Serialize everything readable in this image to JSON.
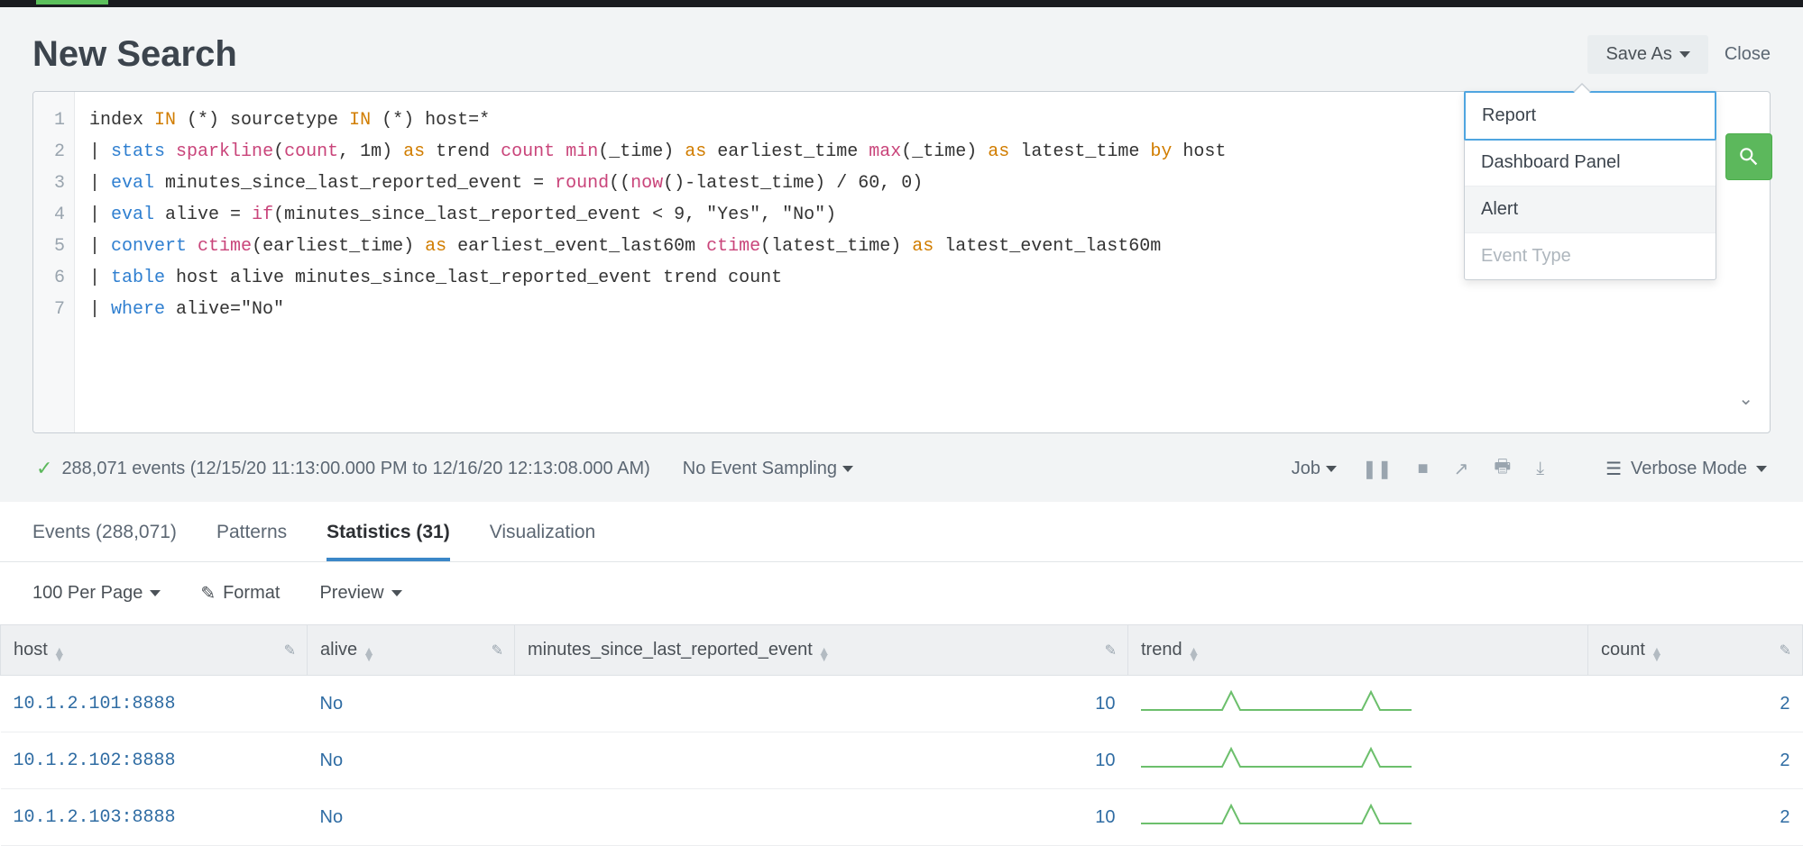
{
  "header": {
    "title": "New Search",
    "save_as": "Save As",
    "close": "Close",
    "dropdown": {
      "report": "Report",
      "dashboard": "Dashboard Panel",
      "alert": "Alert",
      "event_type": "Event Type"
    }
  },
  "query": {
    "lines": [
      "1",
      "2",
      "3",
      "4",
      "5",
      "6",
      "7"
    ],
    "l1": {
      "a": "index ",
      "op1": "IN",
      "b": " (*) sourcetype ",
      "op2": "IN",
      "c": " (*) host=*"
    },
    "l2": {
      "a": "| ",
      "cmd": "stats",
      "sp": " ",
      "fn": "sparkline",
      "b": "(",
      "cnt": "count",
      "c": ", 1m) ",
      "as1": "as",
      "d": " trend ",
      "cnt2": "count",
      "sp2": " ",
      "min": "min",
      "e": "(_time) ",
      "as2": "as",
      "f": " earliest_time ",
      "max": "max",
      "g": "(_time) ",
      "as3": "as",
      "h": " latest_time ",
      "by": "by",
      "i": " host"
    },
    "l3": {
      "a": "| ",
      "cmd": "eval",
      "b": " minutes_since_last_reported_event = ",
      "rnd": "round",
      "c": "((",
      "now": "now",
      "d": "()-latest_time) / 60, 0)"
    },
    "l4": {
      "a": "| ",
      "cmd": "eval",
      "b": " alive = ",
      "iff": "if",
      "c": "(minutes_since_last_reported_event < 9, \"Yes\", \"No\")"
    },
    "l5": {
      "a": "| ",
      "cmd": "convert",
      "sp": " ",
      "ct1": "ctime",
      "b": "(earliest_time) ",
      "as1": "as",
      "c": " earliest_event_last60m ",
      "ct2": "ctime",
      "d": "(latest_time) ",
      "as2": "as",
      "e": " latest_event_last60m"
    },
    "l6": {
      "a": "| ",
      "cmd": "table",
      "b": " host alive minutes_since_last_reported_event trend count"
    },
    "l7": {
      "a": "| ",
      "cmd": "where",
      "b": " alive=\"No\""
    }
  },
  "status": {
    "events_text": "288,071 events (12/15/20 11:13:00.000 PM to 12/16/20 12:13:08.000 AM)",
    "sampling": "No Event Sampling",
    "job": "Job",
    "mode": "Verbose Mode"
  },
  "tabs": {
    "events": "Events (288,071)",
    "patterns": "Patterns",
    "statistics": "Statistics (31)",
    "visualization": "Visualization"
  },
  "controls": {
    "perpage": "100 Per Page",
    "format": "Format",
    "preview": "Preview"
  },
  "table": {
    "headers": {
      "host": "host",
      "alive": "alive",
      "minutes": "minutes_since_last_reported_event",
      "trend": "trend",
      "count": "count"
    },
    "rows": [
      {
        "host": "10.1.2.101:8888",
        "alive": "No",
        "minutes": "10",
        "count": "2"
      },
      {
        "host": "10.1.2.102:8888",
        "alive": "No",
        "minutes": "10",
        "count": "2"
      },
      {
        "host": "10.1.2.103:8888",
        "alive": "No",
        "minutes": "10",
        "count": "2"
      }
    ]
  }
}
